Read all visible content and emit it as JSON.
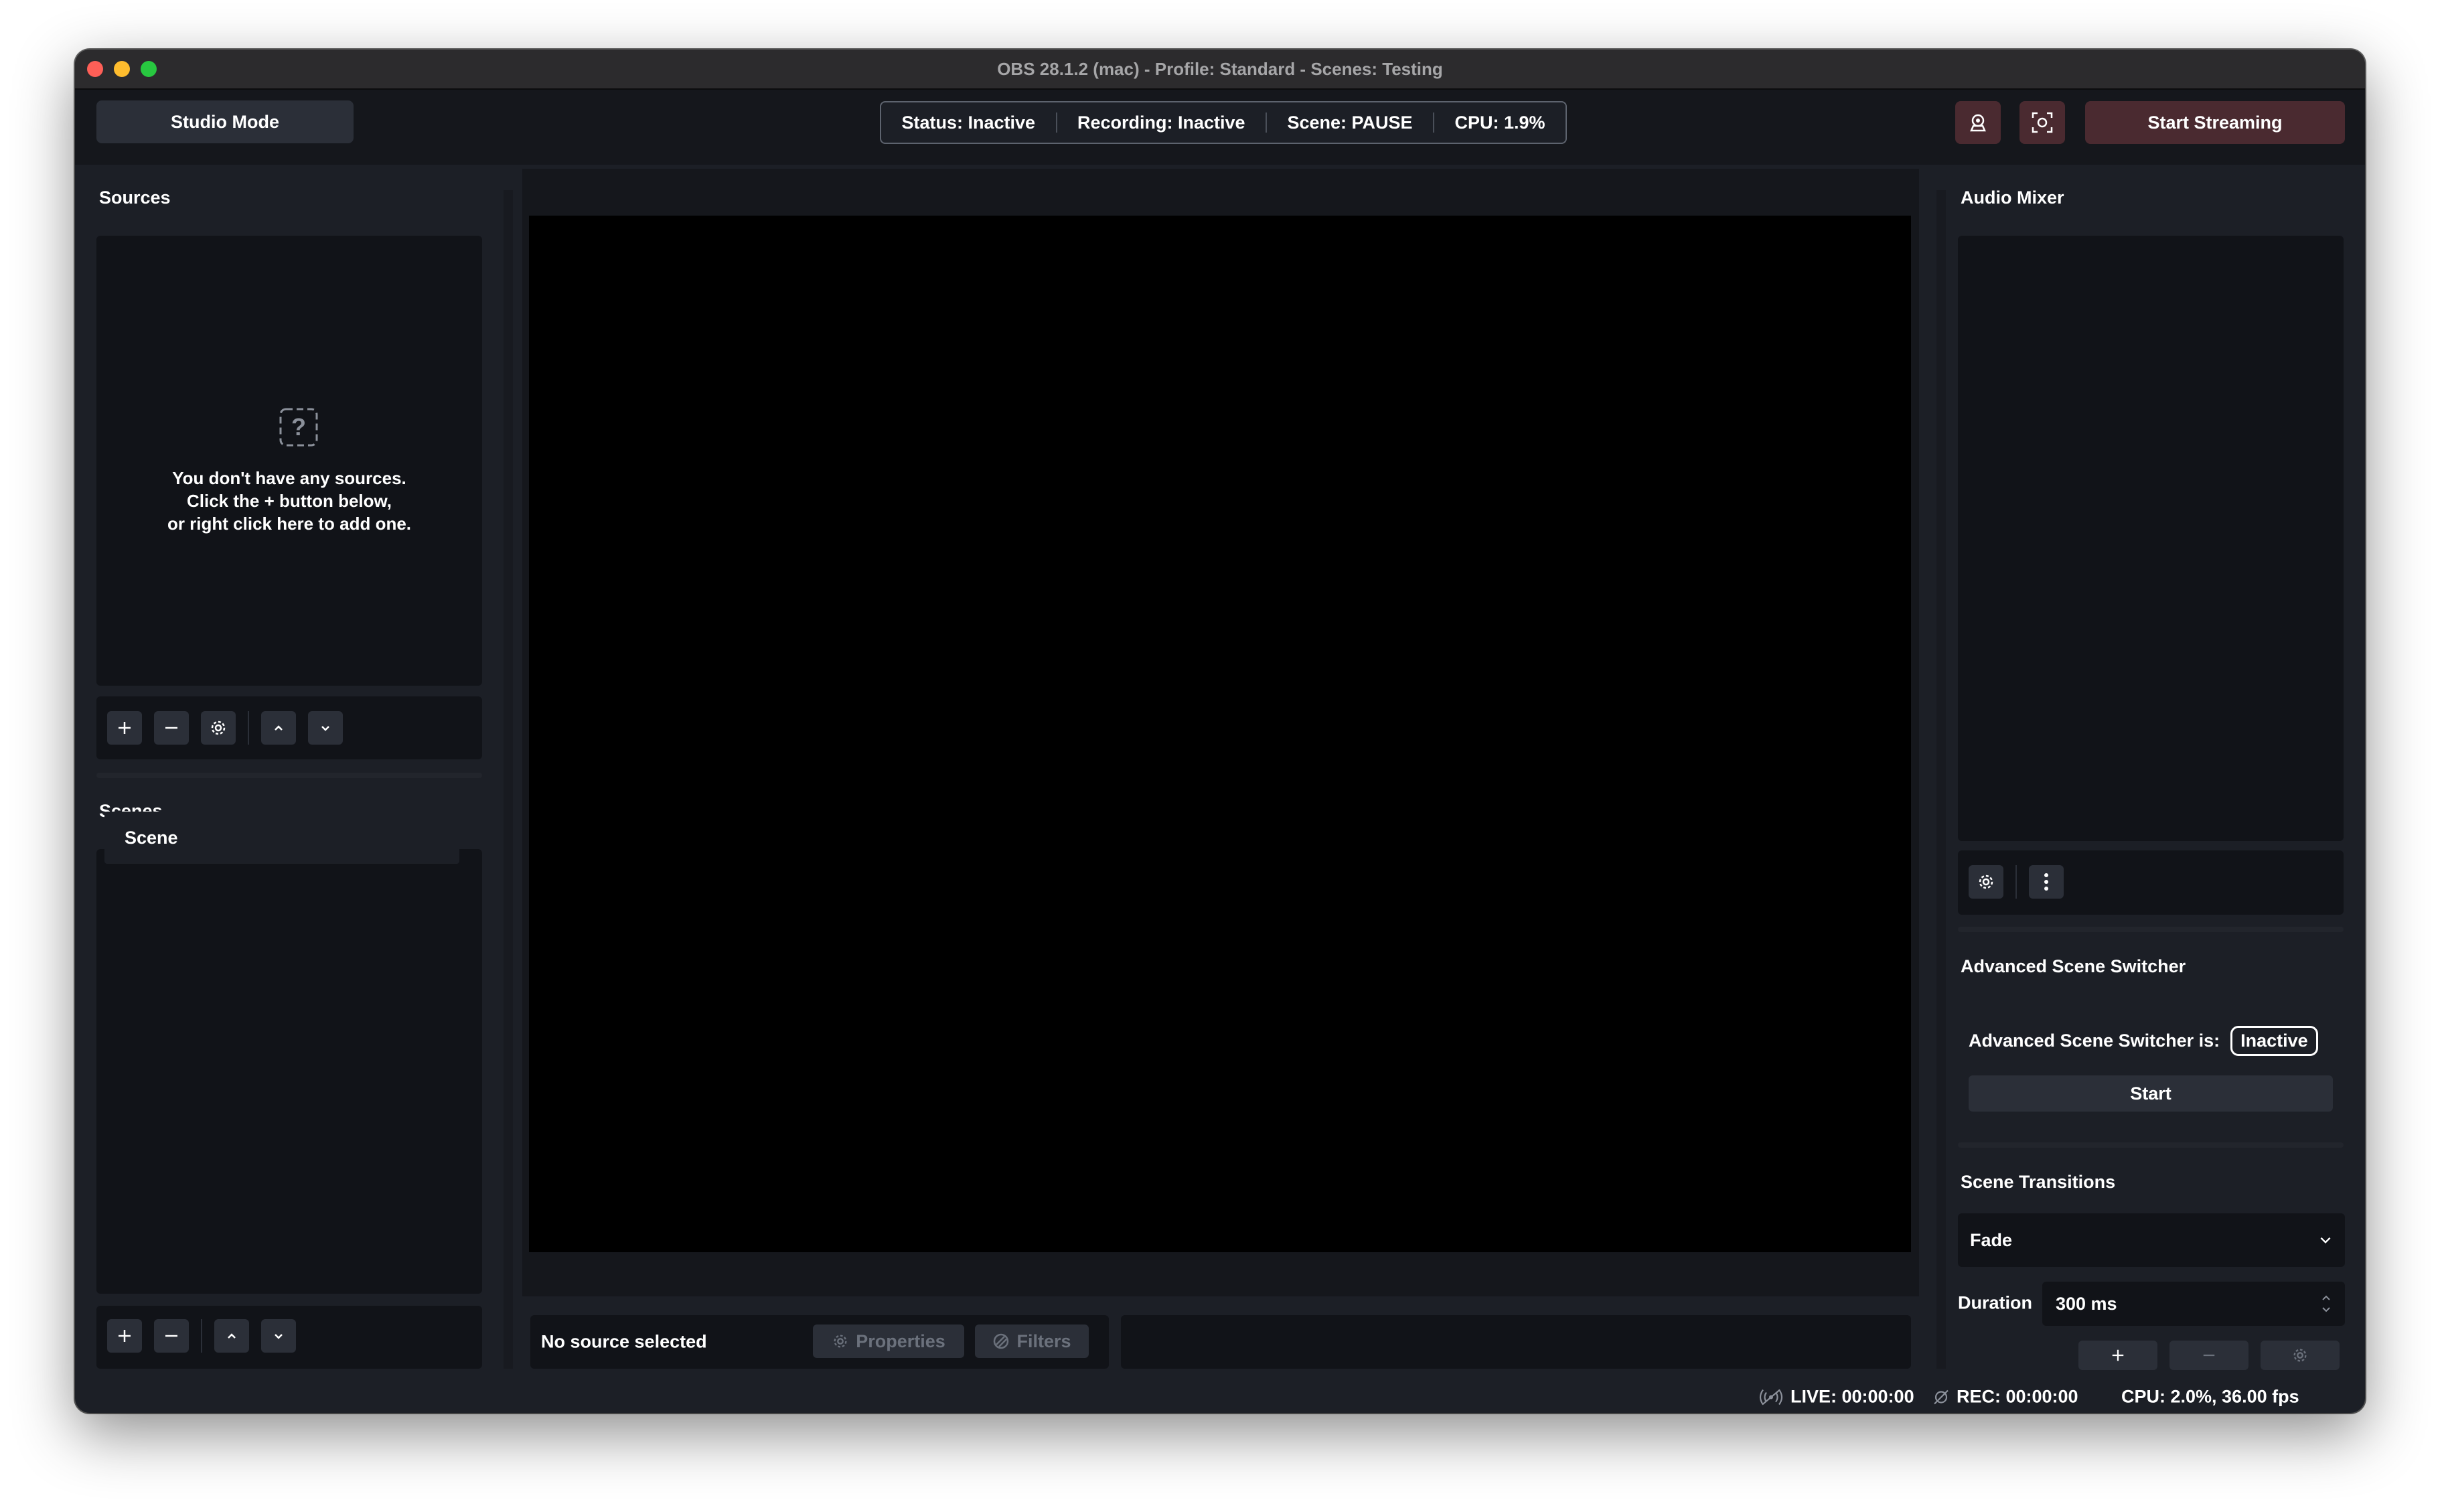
{
  "window": {
    "title": "OBS 28.1.2 (mac) - Profile: Standard - Scenes: Testing"
  },
  "toolbar": {
    "studio_mode_label": "Studio Mode",
    "status": {
      "status": "Status: Inactive",
      "recording": "Recording: Inactive",
      "scene": "Scene: PAUSE",
      "cpu": "CPU: 1.9%"
    },
    "icons": [
      "webcam-icon",
      "screenshot-icon"
    ],
    "start_streaming_label": "Start Streaming"
  },
  "sources": {
    "title": "Sources",
    "empty_icon": "question-mark-icon",
    "empty_line1": "You don't have any sources.",
    "empty_line2": "Click the + button below,",
    "empty_line3": "or right click here to add one."
  },
  "scenes": {
    "title": "Scenes",
    "items": [
      {
        "label": "Scene"
      }
    ]
  },
  "context_bar": {
    "no_source": "No source selected",
    "properties_label": "Properties",
    "filters_label": "Filters"
  },
  "audio_mixer": {
    "title": "Audio Mixer"
  },
  "advanced_scene_switcher": {
    "title": "Advanced Scene Switcher",
    "status_label": "Advanced Scene Switcher is:",
    "status_value": "Inactive",
    "start_label": "Start"
  },
  "scene_transitions": {
    "title": "Scene Transitions",
    "selected": "Fade",
    "duration_label": "Duration",
    "duration_value": "300 ms"
  },
  "statusbar": {
    "live": "LIVE: 00:00:00",
    "rec": "REC: 00:00:00",
    "cpu": "CPU: 2.0%, 36.00 fps"
  },
  "colors": {
    "window_bg": "#1c1f26",
    "panel_bg": "#111318",
    "button_bg": "#2b2f38",
    "stream_button_bg": "#4a2a30",
    "preview_bg": "#000000"
  }
}
